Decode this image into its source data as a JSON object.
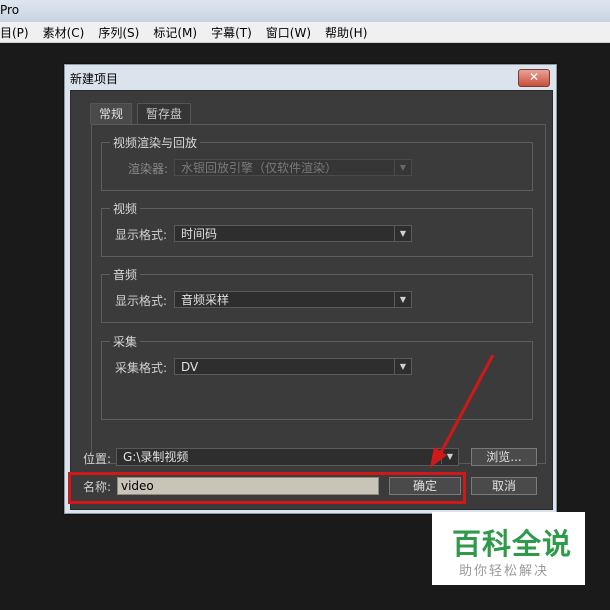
{
  "window": {
    "title": "Pro"
  },
  "menu": [
    "目(P)",
    "素材(C)",
    "序列(S)",
    "标记(M)",
    "字幕(T)",
    "窗口(W)",
    "帮助(H)"
  ],
  "dialog": {
    "title": "新建项目",
    "close": "✕",
    "tabs": {
      "general": "常规",
      "scratch": "暂存盘"
    },
    "render_group": {
      "title": "视频渲染与回放",
      "label": "渲染器:",
      "value": "水银回放引擎（仅软件渲染）"
    },
    "video_group": {
      "title": "视频",
      "label": "显示格式:",
      "value": "时间码"
    },
    "audio_group": {
      "title": "音频",
      "label": "显示格式:",
      "value": "音频采样"
    },
    "capture_group": {
      "title": "采集",
      "label": "采集格式:",
      "value": "DV"
    },
    "location": {
      "label": "位置:",
      "value": "G:\\录制视频",
      "browse": "浏览..."
    },
    "name": {
      "label": "名称:",
      "value": "video"
    },
    "ok": "确定",
    "cancel": "取消"
  },
  "annotation": {
    "highlight_color": "#d01818"
  },
  "watermark": {
    "title": "百科全说",
    "subtitle": "助你轻松解决"
  }
}
